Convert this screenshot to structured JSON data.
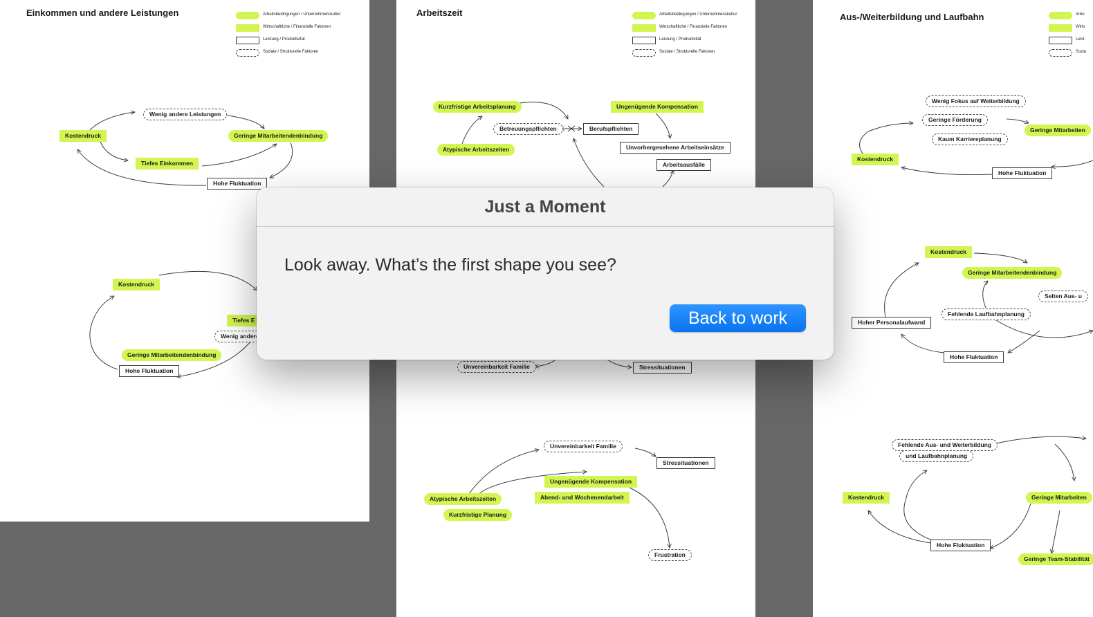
{
  "legend": {
    "items": [
      "Arbeitsbedingungen / Unternehmenskultur",
      "Wirtschaftliche / Finanzielle Faktoren",
      "Leistung / Produktivität",
      "Soziale / Strukturelle Faktoren"
    ],
    "clipped": [
      "Arbe",
      "Wirts",
      "Leist",
      "Sozia"
    ]
  },
  "pages": {
    "p1": {
      "title": "Einkommen und andere Leistungen",
      "d1": {
        "wenig": "Wenig andere Leistungen",
        "kosten": "Kostendruck",
        "geringe": "Geringe Mitarbeitendenbindung",
        "tiefes": "Tiefes Einkommen",
        "hohe": "Hohe Fluktuation"
      },
      "d2": {
        "kosten": "Kostendruck",
        "tiefes": "Tiefes E",
        "wenig": "Wenig andere",
        "geringe": "Geringe Mitarbeitendenbindung",
        "hohe": "Hohe Fluktuation"
      }
    },
    "p2": {
      "title": "Arbeitszeit",
      "d1": {
        "kurz": "Kurzfristige Arbeitsplanung",
        "atyp": "Atypische Arbeitszeiten",
        "betreu": "Betreuungspflichten",
        "beruf": "Berufspflichten",
        "ungen": "Ungenügende Kompensation",
        "unvor": "Unvorhergesehene Arbeitseinsätze",
        "ausf": "Arbeitsausfälle"
      },
      "d2": {
        "unver": "Unvereinbarkeit Familie",
        "stress": "Stressituationen"
      },
      "d3": {
        "unver": "Unvereinbarkeit Familie",
        "stress": "Stressituationen",
        "ungen": "Ungenügende Kompensation",
        "abend": "Abend- und Wochenendarbeit",
        "atyp": "Atypische Arbeitszeiten",
        "kurz": "Kurzfristige Planung",
        "frust": "Frustration"
      }
    },
    "p3": {
      "title": "Aus-/Weiterbildung und Laufbahn",
      "d1": {
        "fokus": "Wenig Fokus auf Weiterbildung",
        "foerd": "Geringe Förderung",
        "karr": "Kaum Karriereplanung",
        "geringe": "Geringe Mitarbeiten",
        "kosten": "Kostendruck",
        "hohe": "Hohe Fluktuation"
      },
      "d2": {
        "kosten": "Kostendruck",
        "geringe": "Geringe Mitarbeitendenbindung",
        "selten": "Selten Aus- u",
        "fehlend": "Fehlende Laufbahnplanung",
        "personal": "Hoher Personalaufwand",
        "hohe": "Hohe Fluktuation"
      },
      "d3": {
        "fehlend1": "Fehlende Aus- und Weiterbildung",
        "fehlend2": "und Laufbahnplanung",
        "kosten": "Kostendruck",
        "geringe": "Geringe Mitarbeiten",
        "hohe": "Hohe Fluktuation",
        "team": "Geringe Team-Stabilität"
      }
    }
  },
  "dialog": {
    "title": "Just a Moment",
    "message": "Look away. What’s the first shape you see?",
    "button": "Back to work"
  }
}
